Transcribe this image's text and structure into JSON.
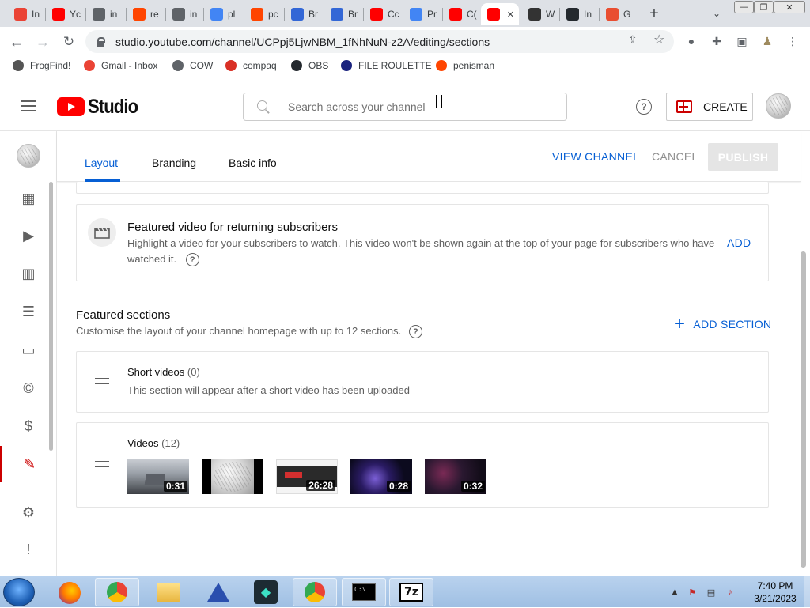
{
  "browser": {
    "tabs": [
      {
        "label": "In",
        "icon": "gmail-icon",
        "color": "#ea4335"
      },
      {
        "label": "Yc",
        "icon": "youtube-icon",
        "color": "#ff0000"
      },
      {
        "label": "in",
        "icon": "globe-icon",
        "color": "#5f6368"
      },
      {
        "label": "re",
        "icon": "reddit-icon",
        "color": "#ff4500"
      },
      {
        "label": "in",
        "icon": "globe-icon",
        "color": "#5f6368"
      },
      {
        "label": "pl",
        "icon": "google-icon",
        "color": "#4285f4"
      },
      {
        "label": "pc",
        "icon": "reddit-icon",
        "color": "#ff4500"
      },
      {
        "label": "Br",
        "icon": "calendar-icon",
        "color": "#3367d6"
      },
      {
        "label": "Br",
        "icon": "calendar-icon",
        "color": "#3367d6"
      },
      {
        "label": "Cc",
        "icon": "youtube-icon",
        "color": "#ff0000"
      },
      {
        "label": "Pr",
        "icon": "google-icon",
        "color": "#4285f4"
      },
      {
        "label": "C(",
        "icon": "youtube-icon",
        "color": "#ff0000"
      },
      {
        "label": "",
        "icon": "youtube-studio-icon",
        "color": "#ff0000",
        "active": true
      },
      {
        "label": "W",
        "icon": "wikipedia-icon",
        "color": "#333333"
      },
      {
        "label": "In",
        "icon": "github-icon",
        "color": "#24292e"
      },
      {
        "label": "G",
        "icon": "git-icon",
        "color": "#e94e31"
      }
    ],
    "close_glyph": "✕",
    "new_tab_glyph": "+",
    "tab_search_glyph": "⌄",
    "window_controls": [
      "—",
      "❐",
      "✕"
    ],
    "url": "studio.youtube.com/channel/UCPpj5LjwNBM_1fNhNuN-z2A/editing/sections",
    "bookmarks": [
      {
        "label": "FrogFind!",
        "icon": "frogfind-icon",
        "color": "#555555"
      },
      {
        "label": "Gmail - Inbox",
        "icon": "gmail-icon",
        "color": "#ea4335"
      },
      {
        "label": "COW",
        "icon": "globe-icon",
        "color": "#5f6368"
      },
      {
        "label": "compaq",
        "icon": "compaq-icon",
        "color": "#d93025"
      },
      {
        "label": "OBS",
        "icon": "github-icon",
        "color": "#24292e"
      },
      {
        "label": "FILE ROULETTE",
        "icon": "roulette-icon",
        "color": "#1a237e"
      },
      {
        "label": "penisman",
        "icon": "reddit-icon",
        "color": "#ff4500"
      }
    ]
  },
  "studio": {
    "logo_text": "Studio",
    "search_placeholder": "Search across your channel",
    "help_glyph": "?",
    "create_label": "CREATE"
  },
  "customisation": {
    "tabs": [
      "Layout",
      "Branding",
      "Basic info"
    ],
    "view_channel": "VIEW CHANNEL",
    "cancel": "CANCEL",
    "publish": "PUBLISH",
    "featured_video": {
      "title": "Featured video for returning subscribers",
      "description_1": "Highlight a video for your subscribers to watch. This video won't be shown again at the top of your page for subscribers who have",
      "description_2": "watched it.",
      "add": "ADD"
    },
    "featured_sections": {
      "title": "Featured sections",
      "description": "Customise the layout of your channel homepage with up to 12 sections.",
      "add_section": "ADD SECTION"
    },
    "sections": [
      {
        "title": "Short videos",
        "count": "(0)",
        "subtitle": "This section will appear after a short video has been uploaded"
      },
      {
        "title": "Videos",
        "count": "(12)"
      }
    ],
    "video_durations": [
      "0:31",
      "",
      "26:28",
      "0:28",
      "0:32"
    ]
  },
  "taskbar": {
    "time": "7:40 PM",
    "date": "3/21/2023"
  },
  "colors": {
    "youtube_red": "#ff0000",
    "link_blue": "#065fd4",
    "active_rail": "#cc0000"
  }
}
